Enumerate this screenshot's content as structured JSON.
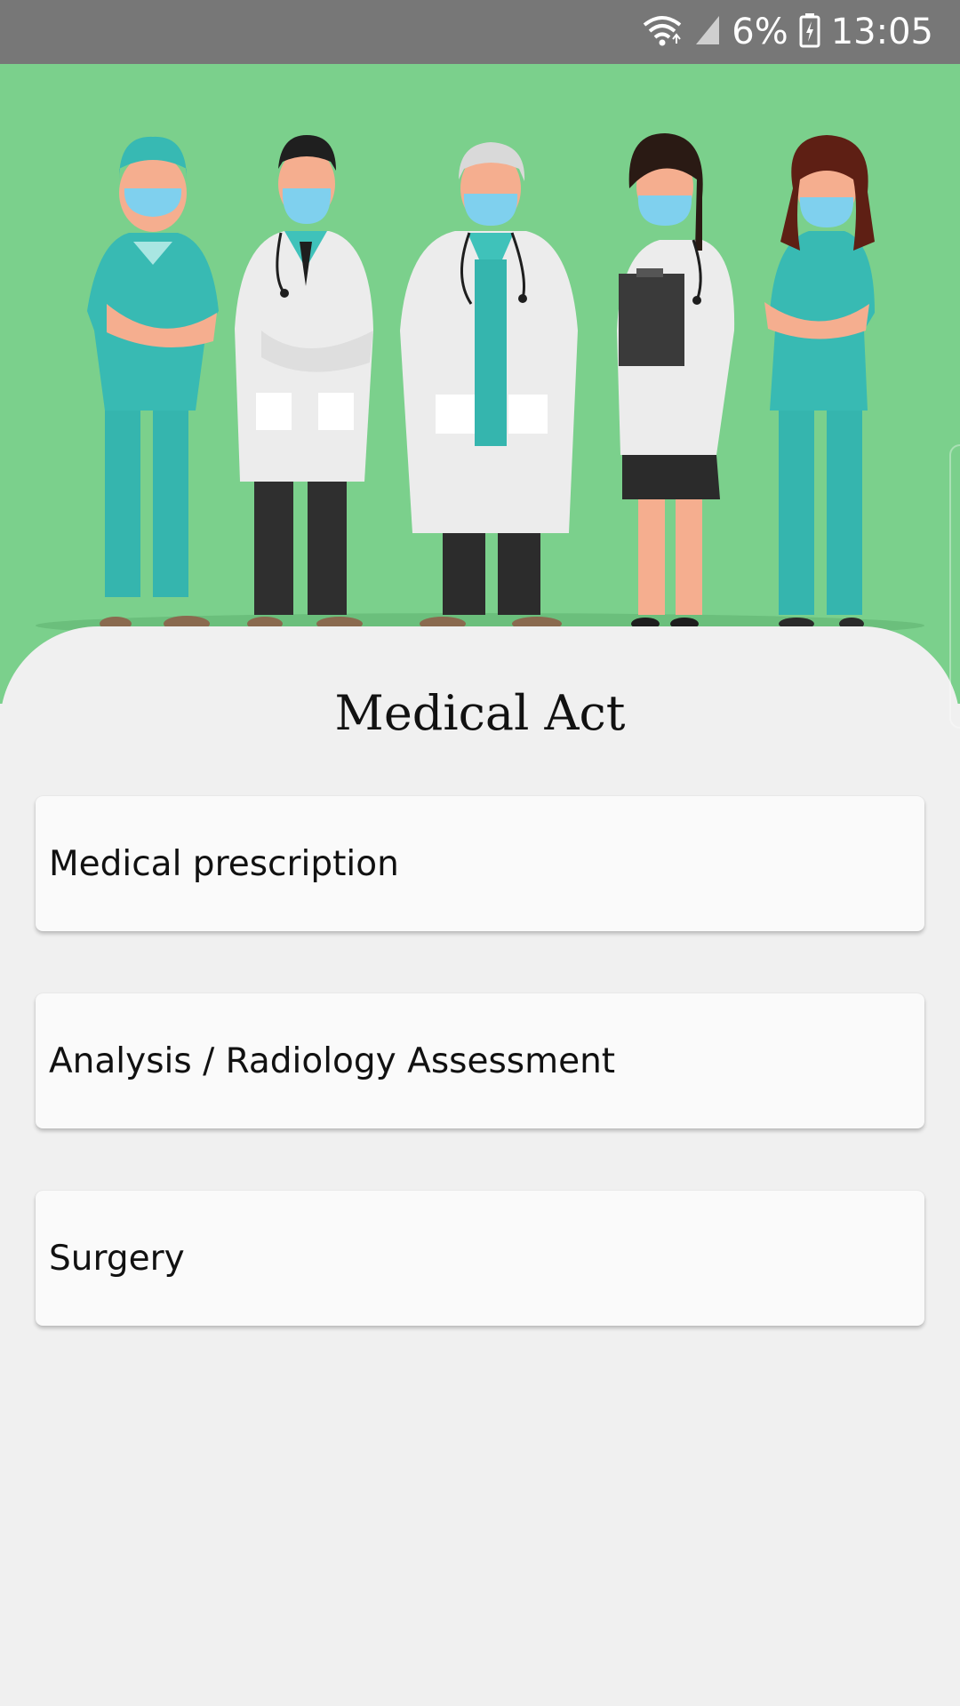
{
  "status_bar": {
    "battery": "6%",
    "time": "13:05",
    "icons": [
      "wifi-icon",
      "signal-icon",
      "battery-icon"
    ]
  },
  "hero": {
    "background_color": "#7bd08c",
    "illustration": "medical-staff-illustration"
  },
  "main": {
    "title": "Medical Act",
    "options": [
      {
        "label": "Medical prescription"
      },
      {
        "label": "Analysis / Radiology Assessment"
      },
      {
        "label": "Surgery"
      }
    ]
  },
  "colors": {
    "status_bar": "#777777",
    "background": "#f0f0f0",
    "card": "#fafafa",
    "teal": "#37b9b3"
  }
}
